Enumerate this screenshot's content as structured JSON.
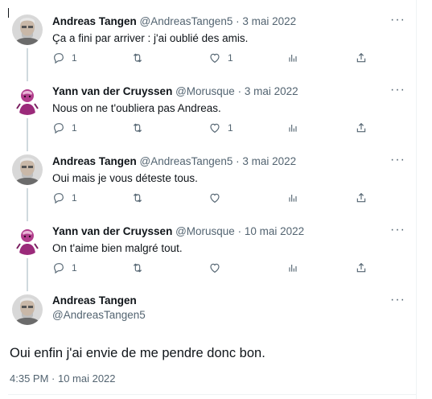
{
  "tweets": [
    {
      "author": "Andreas Tangen",
      "handle": "@AndreasTangen5",
      "date": "3 mai 2022",
      "text": "Ça a fini par arriver : j'ai oublié des amis.",
      "replies": "1",
      "retweets": "",
      "likes": "1",
      "avatar": "andreas"
    },
    {
      "author": "Yann van der Cruyssen",
      "handle": "@Morusque",
      "date": "3 mai 2022",
      "text": "Nous on ne t'oubliera pas Andreas.",
      "replies": "1",
      "retweets": "",
      "likes": "1",
      "avatar": "yann"
    },
    {
      "author": "Andreas Tangen",
      "handle": "@AndreasTangen5",
      "date": "3 mai 2022",
      "text": "Oui mais je vous déteste tous.",
      "replies": "1",
      "retweets": "",
      "likes": "",
      "avatar": "andreas"
    },
    {
      "author": "Yann van der Cruyssen",
      "handle": "@Morusque",
      "date": "10 mai 2022",
      "text": "On t'aime bien malgré tout.",
      "replies": "1",
      "retweets": "",
      "likes": "",
      "avatar": "yann"
    }
  ],
  "main": {
    "author": "Andreas Tangen",
    "handle": "@AndreasTangen5",
    "text": "Oui enfin j'ai envie de me pendre donc bon.",
    "timestamp": "4:35 PM · 10 mai 2022"
  },
  "separator": " · ",
  "more_glyph": "···",
  "colors": {
    "text": "#0f1419",
    "secondary": "#536471",
    "thread_line": "#cfd9de"
  }
}
